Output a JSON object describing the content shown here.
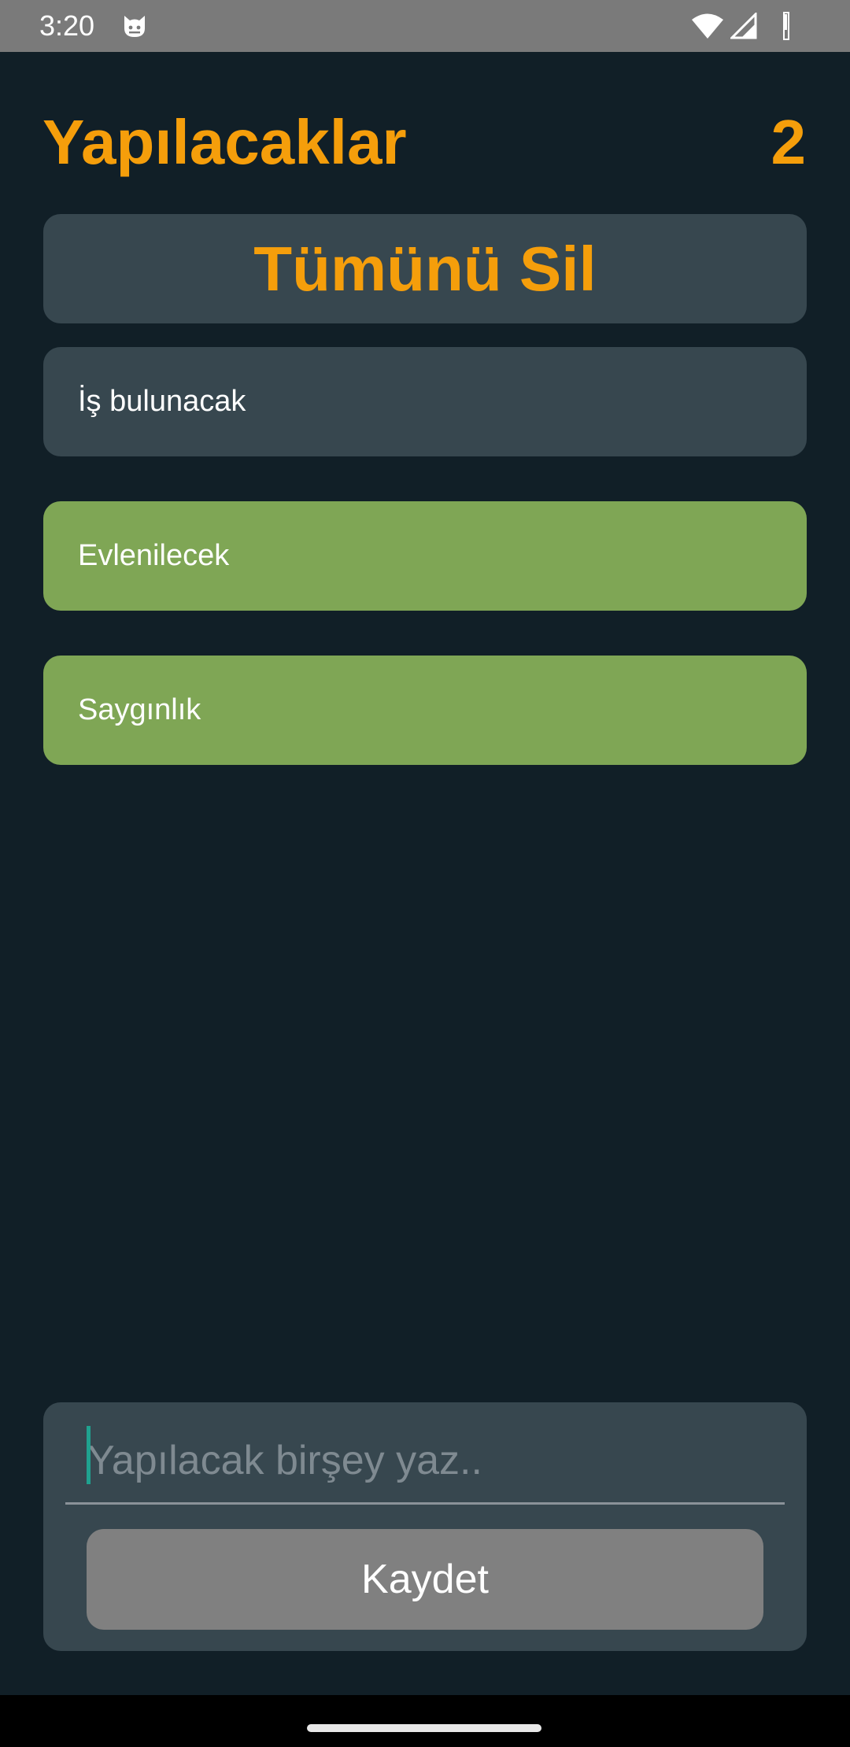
{
  "status_bar": {
    "time": "3:20",
    "icons": [
      "cat-icon",
      "wifi-icon",
      "signal-icon",
      "battery-icon"
    ]
  },
  "header": {
    "title": "Yapılacaklar",
    "count": "2"
  },
  "delete_all_label": "Tümünü Sil",
  "todos": [
    {
      "label": "İş bulunacak",
      "status": "pending"
    },
    {
      "label": "Evlenilecek",
      "status": "done"
    },
    {
      "label": "Saygınlık",
      "status": "done"
    }
  ],
  "input": {
    "value": "",
    "placeholder": "Yapılacak birşey yaz.."
  },
  "save_label": "Kaydet",
  "colors": {
    "background": "#111f27",
    "accent": "#f59e0b",
    "card": "#37474f",
    "done": "#7fa655",
    "button": "#808080",
    "caret": "#1fa28f"
  }
}
